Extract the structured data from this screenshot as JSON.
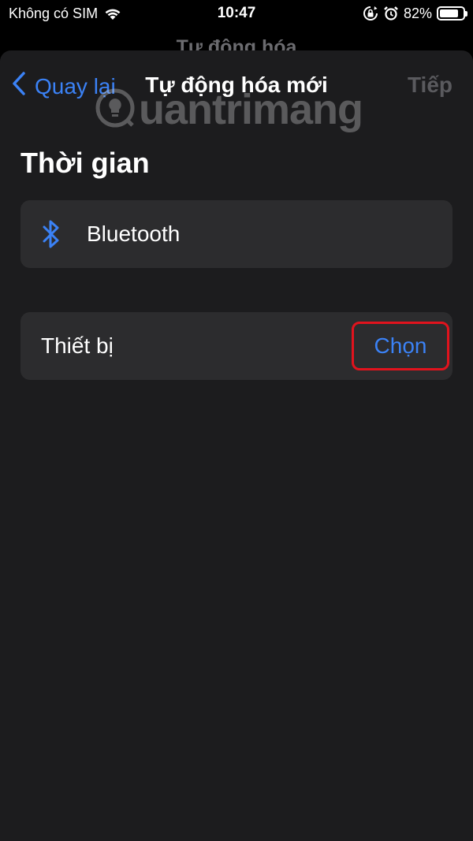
{
  "status_bar": {
    "carrier": "Không có SIM",
    "time": "10:47",
    "battery_percent": "82%",
    "battery_level": 0.82,
    "icons": [
      "wifi-icon",
      "lock-rotation-icon",
      "alarm-icon",
      "battery-icon"
    ]
  },
  "background": {
    "title": "Tự động hóa"
  },
  "nav": {
    "back_label": "Quay lại",
    "title": "Tự động hóa mới",
    "next_label": "Tiếp"
  },
  "watermark": {
    "text": "uantrimang"
  },
  "section": {
    "title": "Thời gian"
  },
  "bluetooth_card": {
    "label": "Bluetooth",
    "icon": "bluetooth-icon"
  },
  "device_card": {
    "label": "Thiết bị",
    "action_label": "Chọn"
  },
  "colors": {
    "accent": "#3b82f6",
    "highlight_border": "#e1131d",
    "sheet_bg": "#1c1c1e",
    "card_bg": "#2c2c2e"
  }
}
